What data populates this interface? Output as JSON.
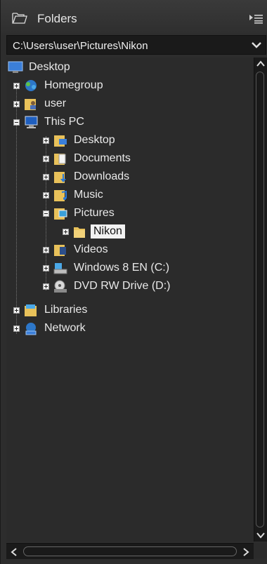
{
  "header": {
    "title": "Folders",
    "icon": "folder-outline-icon",
    "menu_icon": "panel-menu-icon"
  },
  "pathbar": {
    "value": "C:\\Users\\user\\Pictures\\Nikon"
  },
  "tree": {
    "items": [
      {
        "label": "Desktop",
        "icon": "desktop-icon",
        "level": 0,
        "expander": "none"
      },
      {
        "label": "Homegroup",
        "icon": "homegroup-icon",
        "level": 1,
        "expander": "plus"
      },
      {
        "label": "user",
        "icon": "user-folder-icon",
        "level": 1,
        "expander": "plus"
      },
      {
        "label": "This PC",
        "icon": "computer-icon",
        "level": 1,
        "expander": "minus"
      },
      {
        "label": "Desktop",
        "icon": "desktop-folder-icon",
        "level": 2,
        "expander": "plus"
      },
      {
        "label": "Documents",
        "icon": "documents-folder-icon",
        "level": 2,
        "expander": "plus"
      },
      {
        "label": "Downloads",
        "icon": "downloads-folder-icon",
        "level": 2,
        "expander": "plus"
      },
      {
        "label": "Music",
        "icon": "music-folder-icon",
        "level": 2,
        "expander": "plus"
      },
      {
        "label": "Pictures",
        "icon": "pictures-folder-icon",
        "level": 2,
        "expander": "minus"
      },
      {
        "label": "Nikon",
        "icon": "folder-icon",
        "level": 3,
        "expander": "plus",
        "selected": true
      },
      {
        "label": "Videos",
        "icon": "videos-folder-icon",
        "level": 2,
        "expander": "plus"
      },
      {
        "label": "Windows 8 EN (C:)",
        "icon": "drive-icon",
        "level": 2,
        "expander": "plus"
      },
      {
        "label": "DVD RW Drive (D:)",
        "icon": "dvd-drive-icon",
        "level": 2,
        "expander": "plus"
      },
      {
        "label": "Libraries",
        "icon": "libraries-icon",
        "level": 1,
        "expander": "plus"
      },
      {
        "label": "Network",
        "icon": "network-icon",
        "level": 1,
        "expander": "plus"
      }
    ]
  },
  "colors": {
    "panel_bg": "#2b2b2b",
    "path_bg": "#1a1a1a",
    "selection_bg": "#f2f2f2",
    "folder_yellow": "#e8c15a"
  }
}
